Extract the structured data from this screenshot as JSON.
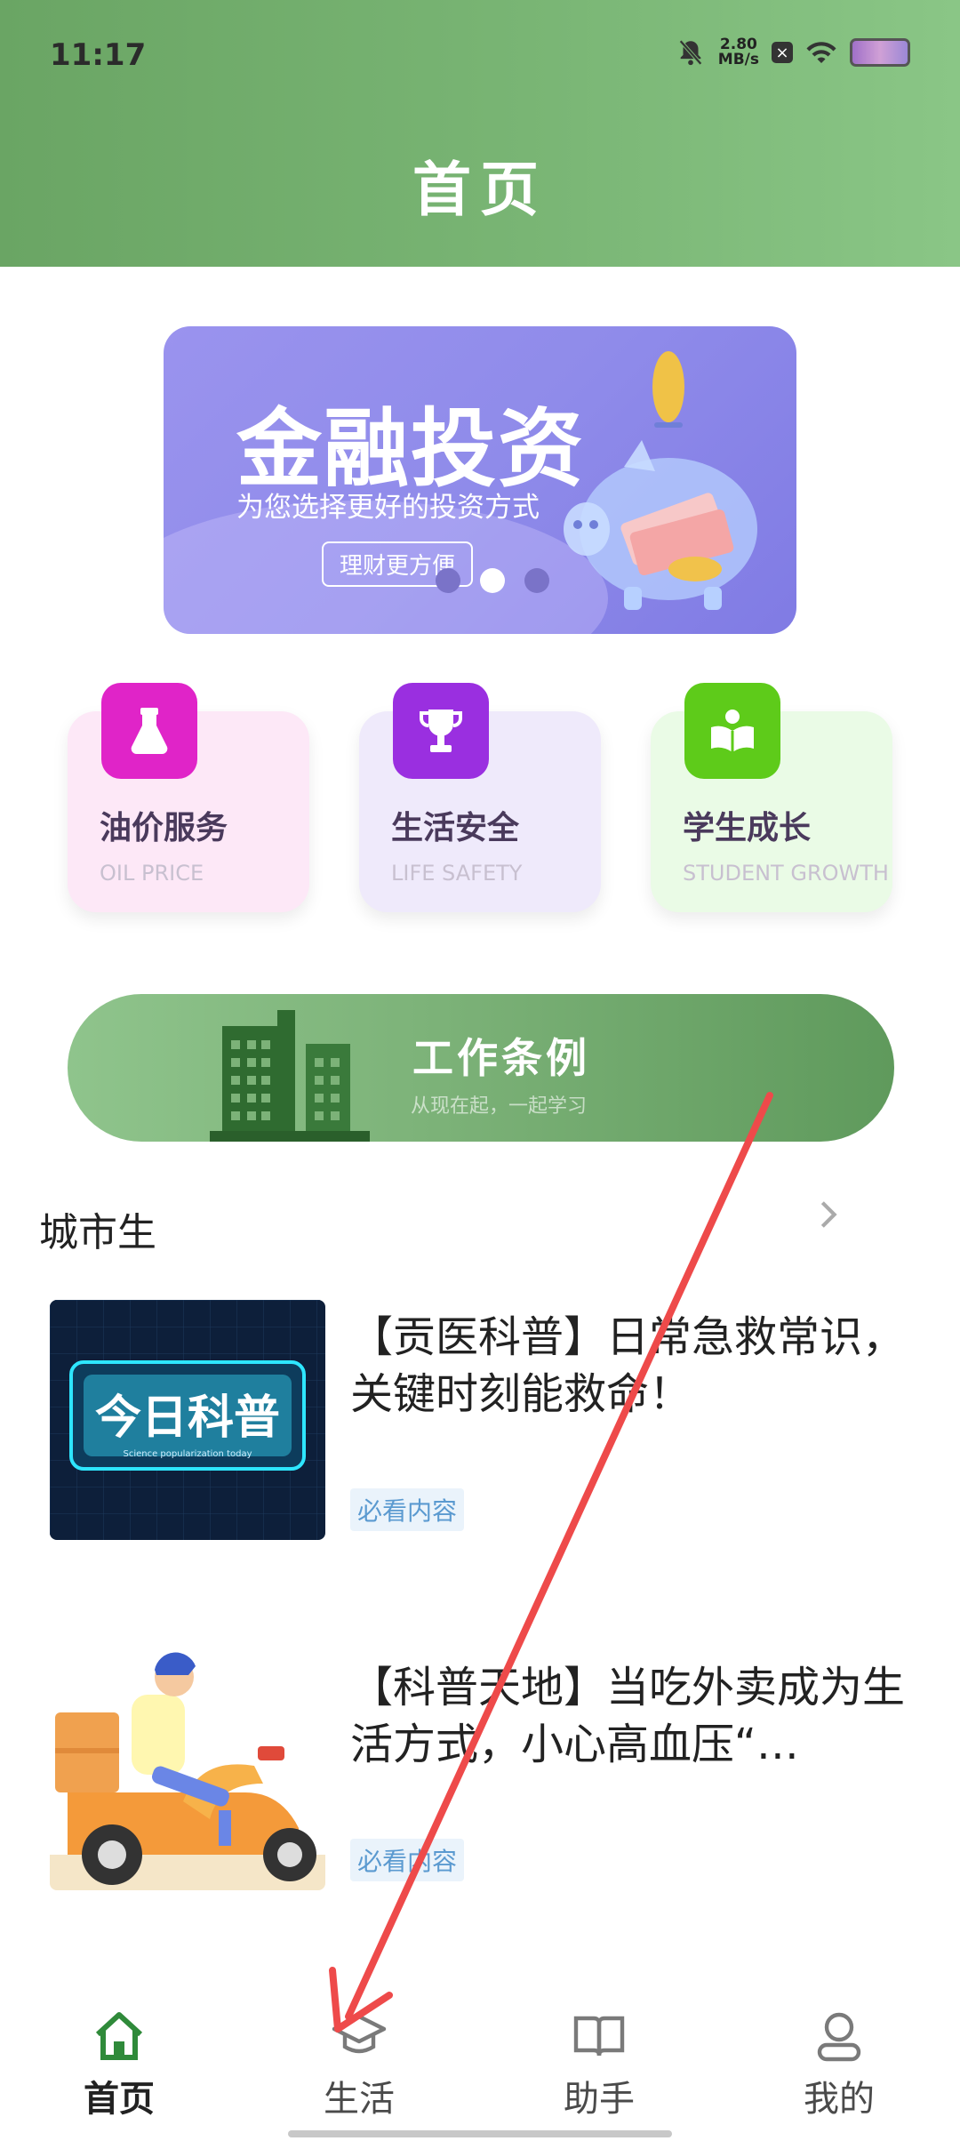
{
  "status_bar": {
    "time": "11:17",
    "net_speed_value": "2.80",
    "net_speed_unit": "MB/s"
  },
  "header": {
    "title": "首页"
  },
  "banner": {
    "title": "金融投资",
    "subtitle": "为您选择更好的投资方式",
    "button": "理财更方便",
    "slides": 3,
    "active_slide": 2
  },
  "categories": [
    {
      "title": "油价服务",
      "en": "OIL PRICE",
      "icon": "flask-icon",
      "bg": "#fde8f7",
      "icon_color": "#e024c8"
    },
    {
      "title": "生活安全",
      "en": "LIFE SAFETY",
      "icon": "trophy-icon",
      "bg": "#efeafb",
      "icon_color": "#9a2fe0"
    },
    {
      "title": "学生成长",
      "en": "STUDENT GROWTH",
      "icon": "book-reader-icon",
      "bg": "#eafbe6",
      "icon_color": "#5ecb1a"
    }
  ],
  "work_banner": {
    "title": "工作条例",
    "subtitle": "从现在起，一起学习"
  },
  "section": {
    "title": "城市生"
  },
  "articles": [
    {
      "title": "【贡医科普】日常急救常识，关键时刻能救命！",
      "tag": "必看内容",
      "thumb_text": "今日科普",
      "thumb_sub": "Science popularization today"
    },
    {
      "title": "【科普天地】当吃外卖成为生活方式，小心高血压“…",
      "tag": "必看内容"
    }
  ],
  "bottom_nav": [
    {
      "label": "首页",
      "icon": "home-icon",
      "active": true
    },
    {
      "label": "生活",
      "icon": "graduation-cap-icon",
      "active": false
    },
    {
      "label": "助手",
      "icon": "book-icon",
      "active": false
    },
    {
      "label": "我的",
      "icon": "user-icon",
      "active": false
    }
  ],
  "colors": {
    "header_green": "#79b574",
    "banner_purple": "#8f8bea",
    "work_green": "#7cb278",
    "tag_blue": "#5b9ad0",
    "annotation_red": "#ee4a4a"
  }
}
